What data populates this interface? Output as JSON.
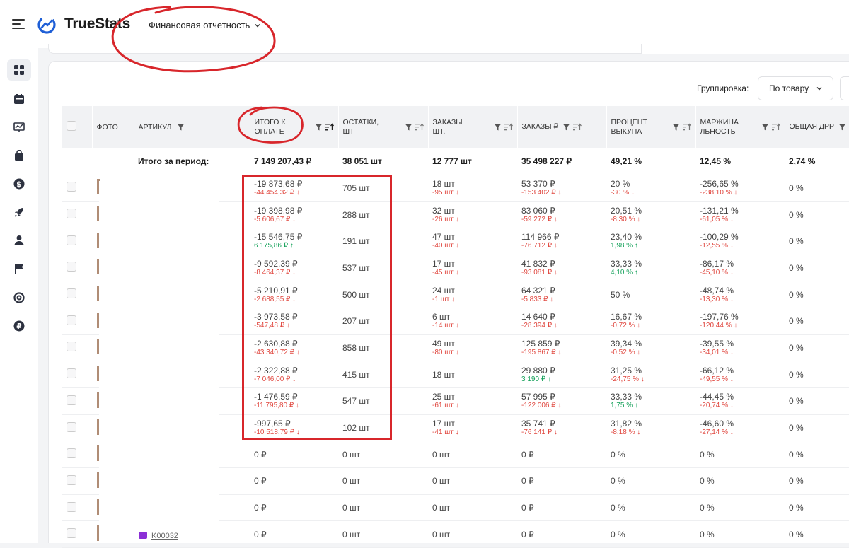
{
  "app": {
    "name": "TrueStats",
    "report_selector": "Финансовая отчетность"
  },
  "colors": {
    "accent": "#1f5fd6",
    "negative": "#e0473f",
    "positive": "#15a15a",
    "annotation": "#d8262b"
  },
  "sidebar": {
    "icons": [
      "dashboard-icon",
      "calendar-icon",
      "chart-icon",
      "shopping-bag-icon",
      "dollar-icon",
      "rocket-icon",
      "user-icon",
      "flag-icon",
      "support-icon",
      "ruble-icon"
    ]
  },
  "toolbar": {
    "grouping_label": "Группировка:",
    "grouping_value": "По товару"
  },
  "table": {
    "headers": {
      "photo": "ФОТО",
      "article": "АРТИКУЛ",
      "payout": "ИТОГО К ОПЛАТЕ",
      "stock": "ОСТАТКИ, ШТ",
      "orders_qty": "ЗАКАЗЫ ШТ.",
      "orders_rub": "ЗАКАЗЫ ₽",
      "buyout": "ПРОЦЕНТ ВЫКУПА",
      "margin": "МАРЖИНА ЛЬНОСТЬ",
      "drr": "ОБЩАЯ ДРР"
    },
    "total": {
      "label": "Итого за период:",
      "payout": "7 149 207,43 ₽",
      "stock": "38 051 шт",
      "orders_qty": "12 777 шт",
      "orders_rub": "35 498 227 ₽",
      "buyout": "49,21 %",
      "margin": "12,45 %",
      "drr": "2,74 %"
    },
    "rows": [
      {
        "payout": "-19 873,68 ₽",
        "payout_d": "-44 454,32 ₽ ↓",
        "payout_dir": "neg",
        "stock": "705 шт",
        "oq": "18 шт",
        "oq_d": "-95 шт ↓",
        "oq_dir": "neg",
        "or": "53 370 ₽",
        "or_d": "-153 402 ₽ ↓",
        "or_dir": "neg",
        "buy": "20 %",
        "buy_d": "-30 % ↓",
        "buy_dir": "neg",
        "mar": "-256,65 %",
        "mar_d": "-238,10 % ↓",
        "mar_dir": "neg",
        "drr": "0 %"
      },
      {
        "payout": "-19 398,98 ₽",
        "payout_d": "-5 606,67 ₽ ↓",
        "payout_dir": "neg",
        "stock": "288 шт",
        "oq": "32 шт",
        "oq_d": "-26 шт ↓",
        "oq_dir": "neg",
        "or": "83 060 ₽",
        "or_d": "-59 272 ₽ ↓",
        "or_dir": "neg",
        "buy": "20,51 %",
        "buy_d": "-8,30 % ↓",
        "buy_dir": "neg",
        "mar": "-131,21 %",
        "mar_d": "-61,05 % ↓",
        "mar_dir": "neg",
        "drr": "0 %"
      },
      {
        "payout": "-15 546,75 ₽",
        "payout_d": "6 175,86 ₽ ↑",
        "payout_dir": "pos",
        "stock": "191 шт",
        "oq": "47 шт",
        "oq_d": "-40 шт ↓",
        "oq_dir": "neg",
        "or": "114 966 ₽",
        "or_d": "-76 712 ₽ ↓",
        "or_dir": "neg",
        "buy": "23,40 %",
        "buy_d": "1,98 % ↑",
        "buy_dir": "pos",
        "mar": "-100,29 %",
        "mar_d": "-12,55 % ↓",
        "mar_dir": "neg",
        "drr": "0 %"
      },
      {
        "payout": "-9 592,39 ₽",
        "payout_d": "-8 464,37 ₽ ↓",
        "payout_dir": "neg",
        "stock": "537 шт",
        "oq": "17 шт",
        "oq_d": "-45 шт ↓",
        "oq_dir": "neg",
        "or": "41 832 ₽",
        "or_d": "-93 081 ₽ ↓",
        "or_dir": "neg",
        "buy": "33,33 %",
        "buy_d": "4,10 % ↑",
        "buy_dir": "pos",
        "mar": "-86,17 %",
        "mar_d": "-45,10 % ↓",
        "mar_dir": "neg",
        "drr": "0 %"
      },
      {
        "payout": "-5 210,91 ₽",
        "payout_d": "-2 688,55 ₽ ↓",
        "payout_dir": "neg",
        "stock": "500 шт",
        "oq": "24 шт",
        "oq_d": "-1 шт ↓",
        "oq_dir": "neg",
        "or": "64 321 ₽",
        "or_d": "-5 833 ₽ ↓",
        "or_dir": "neg",
        "buy": "50 %",
        "buy_d": "",
        "buy_dir": "neg",
        "mar": "-48,74 %",
        "mar_d": "-13,30 % ↓",
        "mar_dir": "neg",
        "drr": "0 %"
      },
      {
        "payout": "-3 973,58 ₽",
        "payout_d": "-547,48 ₽ ↓",
        "payout_dir": "neg",
        "stock": "207 шт",
        "oq": "6 шт",
        "oq_d": "-14 шт ↓",
        "oq_dir": "neg",
        "or": "14 640 ₽",
        "or_d": "-28 394 ₽ ↓",
        "or_dir": "neg",
        "buy": "16,67 %",
        "buy_d": "-0,72 % ↓",
        "buy_dir": "neg",
        "mar": "-197,76 %",
        "mar_d": "-120,44 % ↓",
        "mar_dir": "neg",
        "drr": "0 %"
      },
      {
        "payout": "-2 630,88 ₽",
        "payout_d": "-43 340,72 ₽ ↓",
        "payout_dir": "neg",
        "stock": "858 шт",
        "oq": "49 шт",
        "oq_d": "-80 шт ↓",
        "oq_dir": "neg",
        "or": "125 859 ₽",
        "or_d": "-195 867 ₽ ↓",
        "or_dir": "neg",
        "buy": "39,34 %",
        "buy_d": "-0,52 % ↓",
        "buy_dir": "neg",
        "mar": "-39,55 %",
        "mar_d": "-34,01 % ↓",
        "mar_dir": "neg",
        "drr": "0 %"
      },
      {
        "payout": "-2 322,88 ₽",
        "payout_d": "-7 046,00 ₽ ↓",
        "payout_dir": "neg",
        "stock": "415 шт",
        "oq": "18 шт",
        "oq_d": "",
        "oq_dir": "neg",
        "or": "29 880 ₽",
        "or_d": "3 190 ₽ ↑",
        "or_dir": "pos",
        "buy": "31,25 %",
        "buy_d": "-24,75 % ↓",
        "buy_dir": "neg",
        "mar": "-66,12 %",
        "mar_d": "-49,55 % ↓",
        "mar_dir": "neg",
        "drr": "0 %"
      },
      {
        "payout": "-1 476,59 ₽",
        "payout_d": "-11 795,80 ₽ ↓",
        "payout_dir": "neg",
        "stock": "547 шт",
        "oq": "25 шт",
        "oq_d": "-61 шт ↓",
        "oq_dir": "neg",
        "or": "57 995 ₽",
        "or_d": "-122 006 ₽ ↓",
        "or_dir": "neg",
        "buy": "33,33 %",
        "buy_d": "1,75 % ↑",
        "buy_dir": "pos",
        "mar": "-44,45 %",
        "mar_d": "-20,74 % ↓",
        "mar_dir": "neg",
        "drr": "0 %"
      },
      {
        "payout": "-997,65 ₽",
        "payout_d": "-10 518,79 ₽ ↓",
        "payout_dir": "neg",
        "stock": "102 шт",
        "oq": "17 шт",
        "oq_d": "-41 шт ↓",
        "oq_dir": "neg",
        "or": "35 741 ₽",
        "or_d": "-76 141 ₽ ↓",
        "or_dir": "neg",
        "buy": "31,82 %",
        "buy_d": "-8,18 % ↓",
        "buy_dir": "neg",
        "mar": "-46,60 %",
        "mar_d": "-27,14 % ↓",
        "mar_dir": "neg",
        "drr": "0 %"
      },
      {
        "payout": "0 ₽",
        "payout_d": "",
        "payout_dir": "neg",
        "stock": "0 шт",
        "oq": "0 шт",
        "oq_d": "",
        "oq_dir": "neg",
        "or": "0 ₽",
        "or_d": "",
        "or_dir": "neg",
        "buy": "0 %",
        "buy_d": "",
        "buy_dir": "neg",
        "mar": "0 %",
        "mar_d": "",
        "mar_dir": "neg",
        "drr": "0 %"
      },
      {
        "payout": "0 ₽",
        "payout_d": "",
        "payout_dir": "neg",
        "stock": "0 шт",
        "oq": "0 шт",
        "oq_d": "",
        "oq_dir": "neg",
        "or": "0 ₽",
        "or_d": "",
        "or_dir": "neg",
        "buy": "0 %",
        "buy_d": "",
        "buy_dir": "neg",
        "mar": "0 %",
        "mar_d": "",
        "mar_dir": "neg",
        "drr": "0 %"
      },
      {
        "payout": "0 ₽",
        "payout_d": "",
        "payout_dir": "neg",
        "stock": "0 шт",
        "oq": "0 шт",
        "oq_d": "",
        "oq_dir": "neg",
        "or": "0 ₽",
        "or_d": "",
        "or_dir": "neg",
        "buy": "0 %",
        "buy_d": "",
        "buy_dir": "neg",
        "mar": "0 %",
        "mar_d": "",
        "mar_dir": "neg",
        "drr": "0 %"
      },
      {
        "payout": "0 ₽",
        "payout_d": "",
        "payout_dir": "neg",
        "stock": "0 шт",
        "oq": "0 шт",
        "oq_d": "",
        "oq_dir": "neg",
        "or": "0 ₽",
        "or_d": "",
        "or_dir": "neg",
        "buy": "0 %",
        "buy_d": "",
        "buy_dir": "neg",
        "mar": "0 %",
        "mar_d": "",
        "mar_dir": "neg",
        "drr": "0 %"
      }
    ]
  },
  "bottom_tag": "K00032"
}
